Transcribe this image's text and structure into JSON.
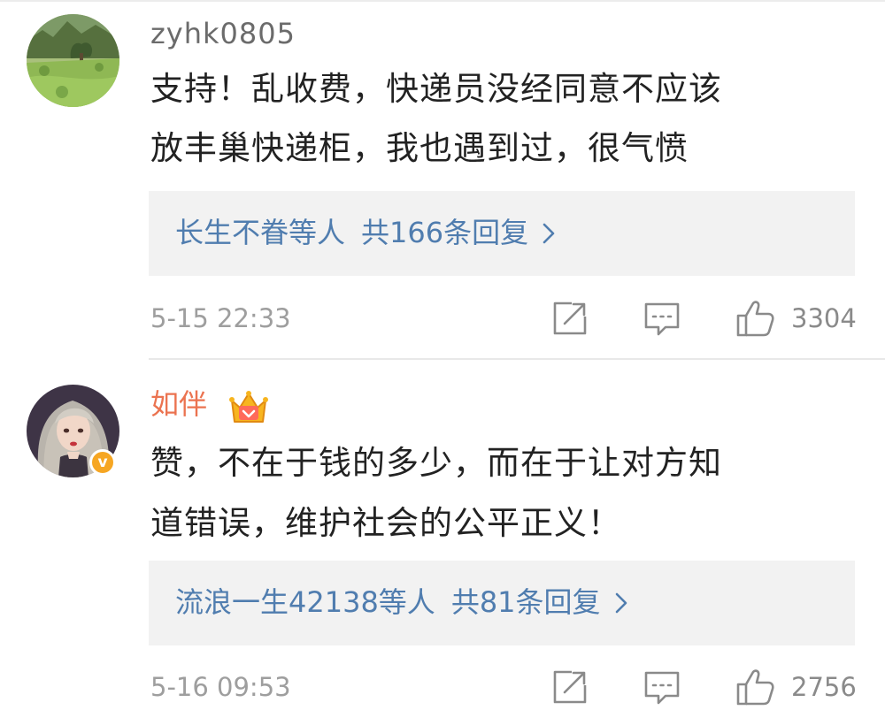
{
  "comments": [
    {
      "username": "zyhk0805",
      "body_line_1": "支持！乱收费，快递员没经同意不应该",
      "body_line_2": "放丰巢快递柜，我也遇到过，很气愤",
      "reply_names": "长生不眷等人",
      "reply_count": "共166条回复",
      "time": "5-15 22:33",
      "likes": "3304"
    },
    {
      "username": "如伴",
      "verified_badge": "v",
      "body_line_1": "赞，不在于钱的多少，而在于让对方知",
      "body_line_2": "道错误，维护社会的公平正义！",
      "reply_names": "流浪一生42138等人",
      "reply_count": "共81条回复",
      "time": "5-16 09:53",
      "likes": "2756"
    }
  ],
  "icons": {
    "avatar_1": "landscape-avatar-icon",
    "avatar_2": "illustrated-girl-avatar-icon",
    "verified": "v-badge-icon",
    "vip": "crown-badge-icon",
    "reply_arrow": "chevron-right-icon",
    "share": "share-icon",
    "comment": "comment-icon",
    "like": "thumbs-up-icon"
  },
  "colors": {
    "username_default": "#6b6b6b",
    "username_vip": "#eb7350",
    "link_blue": "#507daf",
    "reply_bg": "#f2f2f2",
    "muted": "#9e9e9e",
    "verified_orange": "#f6a623"
  }
}
